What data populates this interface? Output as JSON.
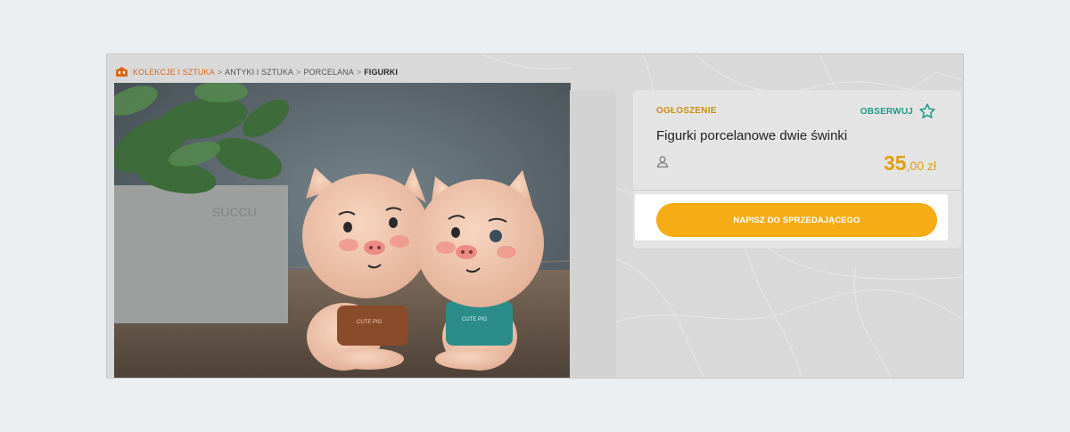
{
  "breadcrumb": {
    "items": [
      "KOLEKCJE I SZTUKA",
      "ANTYKI I SZTUKA",
      "PORCELANA",
      "FIGURKI"
    ],
    "separator": ">"
  },
  "listing": {
    "type_label": "OGŁOSZENIE",
    "follow_label": "OBSERWUJ",
    "title": "Figurki porcelanowe dwie świnki",
    "price_main": "35",
    "price_fraction": ",00 zł"
  },
  "cta": {
    "label": "NAPISZ DO SPRZEDAJĄCEGO"
  },
  "photo": {
    "apron_left_text": "CUTE PIG",
    "apron_right_text": "CUTE PIG"
  },
  "colors": {
    "accent_orange": "#d96a19",
    "price_gold": "#e09e10",
    "button_yellow": "#f6ac14",
    "follow_teal": "#1e9a8a"
  },
  "icons": [
    "home-icon",
    "star-icon",
    "user-icon"
  ]
}
